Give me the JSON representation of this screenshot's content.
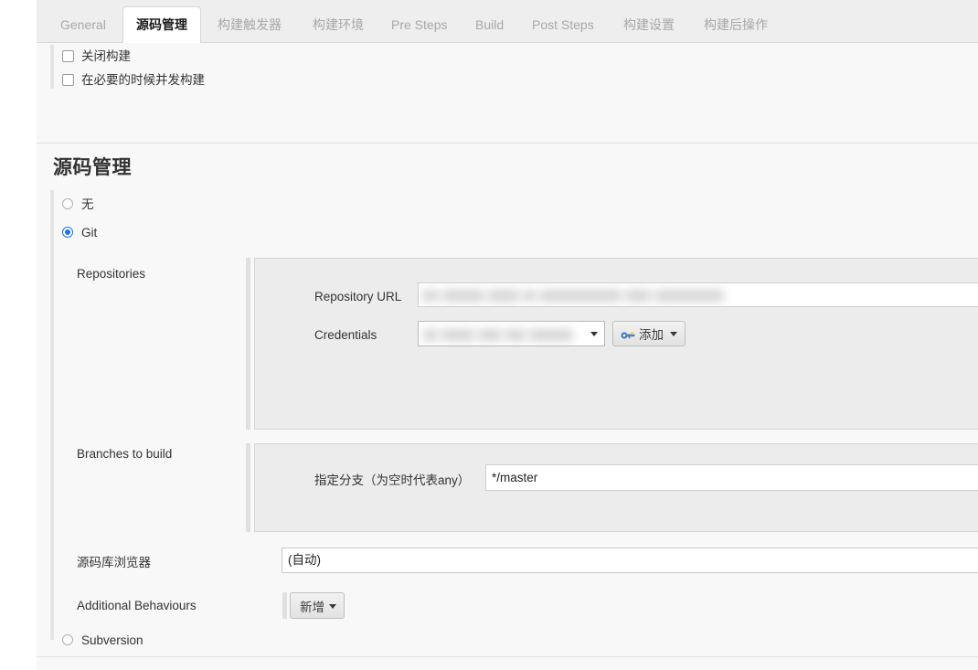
{
  "tabs": [
    {
      "label": "General",
      "active": false,
      "cjk": false
    },
    {
      "label": "源码管理",
      "active": true,
      "cjk": true
    },
    {
      "label": "构建触发器",
      "active": false,
      "cjk": true
    },
    {
      "label": "构建环境",
      "active": false,
      "cjk": true
    },
    {
      "label": "Pre Steps",
      "active": false,
      "cjk": false
    },
    {
      "label": "Build",
      "active": false,
      "cjk": false
    },
    {
      "label": "Post Steps",
      "active": false,
      "cjk": false
    },
    {
      "label": "构建设置",
      "active": false,
      "cjk": true
    },
    {
      "label": "构建后操作",
      "active": false,
      "cjk": true
    }
  ],
  "general": {
    "checkboxes": [
      {
        "label": "关闭构建",
        "checked": false
      },
      {
        "label": "在必要的时候并发构建",
        "checked": false
      }
    ]
  },
  "scm": {
    "title": "源码管理",
    "options": [
      {
        "label": "无",
        "selected": false
      },
      {
        "label": "Git",
        "selected": true
      },
      {
        "label": "Subversion",
        "selected": false
      }
    ],
    "repositories": {
      "label": "Repositories",
      "repository_url": {
        "label": "Repository URL",
        "value": "",
        "redacted": true
      },
      "credentials": {
        "label": "Credentials",
        "value": "",
        "redacted": true,
        "add_button": {
          "label": "添加",
          "icon": "key-icon"
        }
      }
    },
    "branches": {
      "label": "Branches to build",
      "branch_specifier": {
        "label": "指定分支（为空时代表any）",
        "value": "*/master"
      }
    },
    "repository_browser": {
      "label": "源码库浏览器",
      "value": "(自动)"
    },
    "additional_behaviours": {
      "label": "Additional Behaviours",
      "add_button_label": "新增"
    }
  },
  "colors": {
    "accent": "#1a73e8",
    "panel_bg": "#f8f8f8",
    "inner_panel_bg": "#ececec",
    "tabbar_bg": "#eeeeee",
    "border": "#d6d6d6",
    "text": "#333333",
    "muted_text": "#a8a8a8"
  }
}
